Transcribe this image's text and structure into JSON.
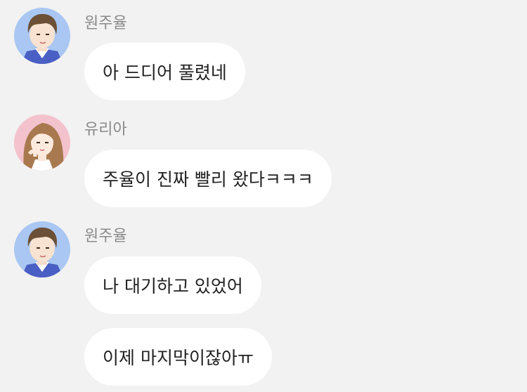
{
  "chat": {
    "messages": [
      {
        "sender": "원주율",
        "avatar_icon": "boy-avatar-icon",
        "bubbles": [
          "아 드디어 풀렸네"
        ]
      },
      {
        "sender": "유리아",
        "avatar_icon": "girl-avatar-icon",
        "bubbles": [
          "주율이 진짜 빨리 왔다ㅋㅋㅋ"
        ]
      },
      {
        "sender": "원주율",
        "avatar_icon": "boy-avatar-icon",
        "bubbles": [
          "나 대기하고 있었어",
          "이제 마지막이잖아ㅠ"
        ]
      }
    ]
  },
  "colors": {
    "background": "#f2f2f2",
    "bubble": "#ffffff",
    "sender_text": "#8a8a8a",
    "message_text": "#222222",
    "boy_avatar_bg": "#a9c7f2",
    "girl_avatar_bg": "#f3c2cd"
  }
}
